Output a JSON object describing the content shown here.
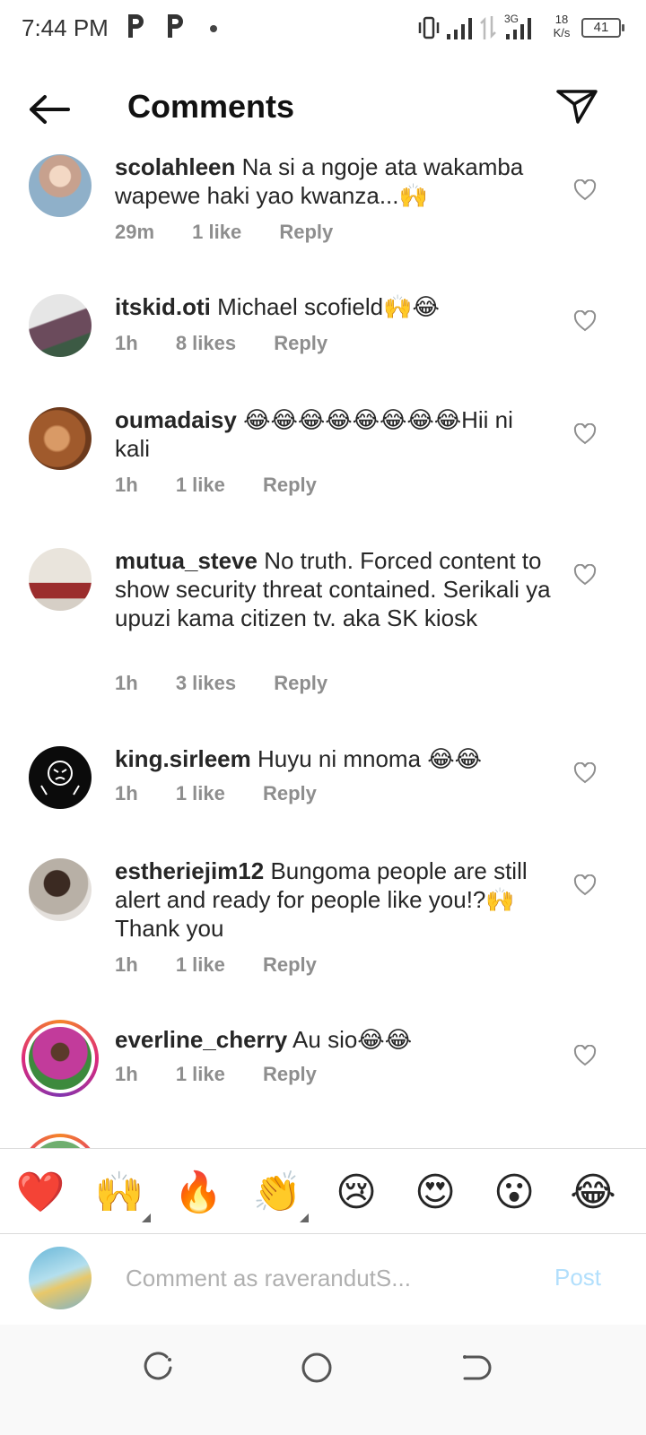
{
  "status_bar": {
    "time": "7:44 PM",
    "notifications": [
      "p-app-icon",
      "p-app-icon"
    ],
    "network": "3G",
    "speed_value": "18",
    "speed_unit": "K/s",
    "battery": "41"
  },
  "header": {
    "title": "Comments",
    "back_icon": "arrow-left-icon",
    "share_icon": "send-icon"
  },
  "comments": [
    {
      "username": "scolahleen",
      "text": "Na si a ngoje ata wakamba wapewe haki yao kwanza...🙌",
      "time": "29m",
      "likes": "1 like",
      "reply": "Reply"
    },
    {
      "username": "itskid.oti",
      "text": "Michael scofield🙌😂",
      "time": "1h",
      "likes": "8 likes",
      "reply": "Reply"
    },
    {
      "username": "oumadaisy",
      "text": "😂😂😂😂😂😂😂😂Hii ni kali",
      "time": "1h",
      "likes": "1 like",
      "reply": "Reply"
    },
    {
      "username": "mutua_steve",
      "text": "No truth. Forced content to show security threat contained. Serikali ya upuzi kama citizen tv. aka SK kiosk",
      "time": "1h",
      "likes": "3 likes",
      "reply": "Reply"
    },
    {
      "username": "king.sirleem",
      "text": "Huyu ni mnoma 😂😂",
      "time": "1h",
      "likes": "1 like",
      "reply": "Reply"
    },
    {
      "username": "estheriejim12",
      "text": "Bungoma people are still alert and ready for people like you!?🙌 Thank you",
      "time": "1h",
      "likes": "1 like",
      "reply": "Reply"
    },
    {
      "username": "everline_cherry",
      "text": "Au sio😂😂",
      "time": "1h",
      "likes": "1 like",
      "reply": "Reply"
    }
  ],
  "quick_reactions": [
    "❤️",
    "🙌",
    "🔥",
    "👏",
    "😢",
    "😍",
    "😮",
    "😂"
  ],
  "composer": {
    "placeholder": "Comment as raverandutS...",
    "post_label": "Post"
  },
  "colors": {
    "text": "#262626",
    "meta": "#8e8e8e",
    "post_disabled": "#b2dffc",
    "divider": "#dbdbdb"
  }
}
